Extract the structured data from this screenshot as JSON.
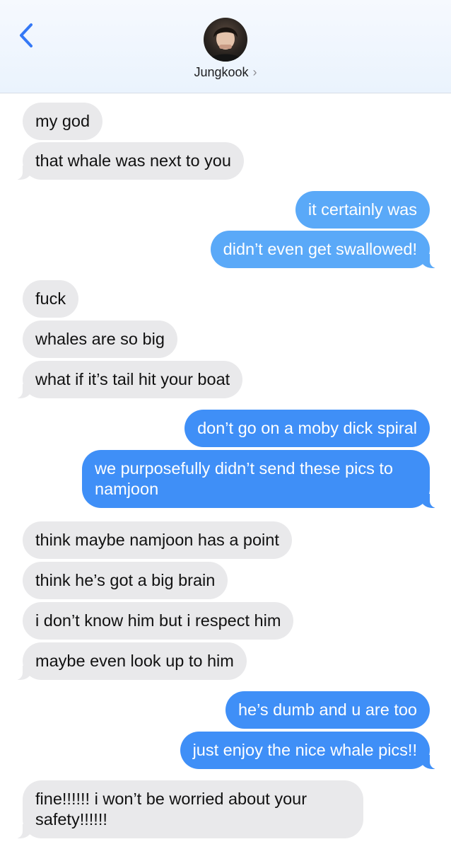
{
  "header": {
    "contact_name": "Jungkook",
    "chevron": "›",
    "back_icon": "chevron-left-icon",
    "accent": "#3478f6"
  },
  "messages": [
    {
      "side": "in",
      "text": "my god"
    },
    {
      "side": "in",
      "text": "that whale was next to you"
    },
    {
      "side": "out",
      "text": "it certainly was"
    },
    {
      "side": "out",
      "text": "didn’t even get swallowed!"
    },
    {
      "side": "in",
      "text": "fuck"
    },
    {
      "side": "in",
      "text": "whales are so big"
    },
    {
      "side": "in",
      "text": "what if it’s tail hit your boat"
    },
    {
      "side": "out",
      "text": "don’t go on a moby dick spiral"
    },
    {
      "side": "out",
      "text": "we purposefully didn’t send these pics to namjoon"
    },
    {
      "side": "in",
      "text": "think maybe namjoon has a point"
    },
    {
      "side": "in",
      "text": "think he’s got a big brain"
    },
    {
      "side": "in",
      "text": "i don’t know him but i respect him"
    },
    {
      "side": "in",
      "text": "maybe even look up to him"
    },
    {
      "side": "out",
      "text": "he’s dumb and u are too"
    },
    {
      "side": "out",
      "text": "just enjoy the nice whale pics!!"
    },
    {
      "side": "in",
      "text": "fine!!!!!! i won’t be worried about your safety!!!!!!"
    }
  ],
  "colors": {
    "incoming_bubble": "#e9e9eb",
    "outgoing_bubble": "#3f8ff7",
    "outgoing_bubble_top": "#5aa9f8"
  }
}
